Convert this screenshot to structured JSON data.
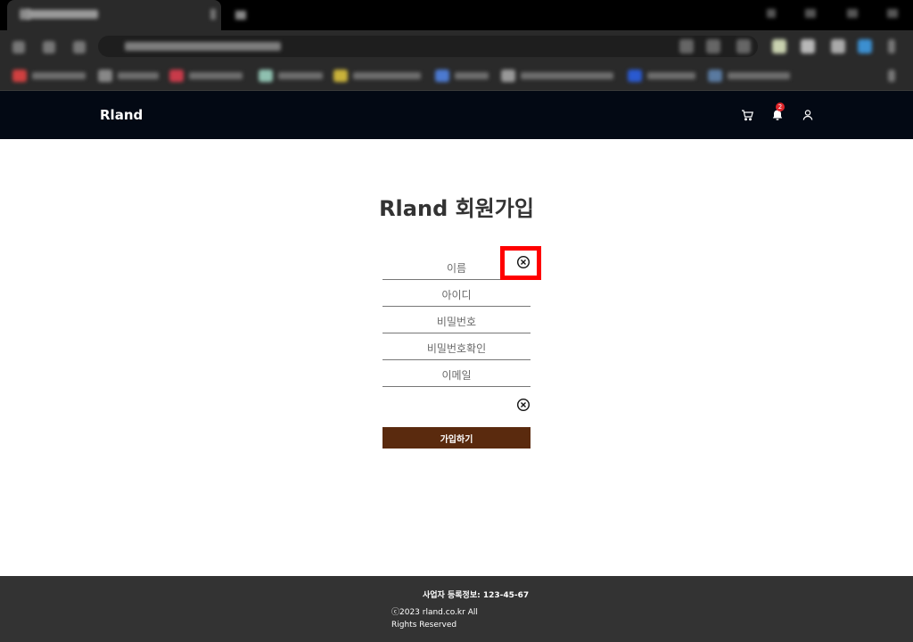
{
  "site": {
    "logo": "Rland",
    "notification_count": "2"
  },
  "page": {
    "title": "Rland 회원가입"
  },
  "form": {
    "fields": [
      {
        "placeholder": "이름",
        "value": ""
      },
      {
        "placeholder": "아이디",
        "value": ""
      },
      {
        "placeholder": "비밀번호",
        "value": ""
      },
      {
        "placeholder": "비밀번호확인",
        "value": ""
      },
      {
        "placeholder": "이메일",
        "value": ""
      }
    ],
    "submit_label": "가입하기"
  },
  "footer": {
    "business_info": "사업자 등록정보: 123-45-67",
    "copyright": "ⓒ2023 rland.co.kr All Rights Reserved"
  },
  "icons": {
    "cart": "cart-icon",
    "notification": "bell-icon",
    "user": "user-icon",
    "clear": "circle-x-icon"
  },
  "colors": {
    "header_bg": "#030914",
    "submit_bg": "#5a2a0e",
    "footer_bg": "#333333",
    "badge": "#e0262b",
    "highlight": "#ff0000"
  }
}
